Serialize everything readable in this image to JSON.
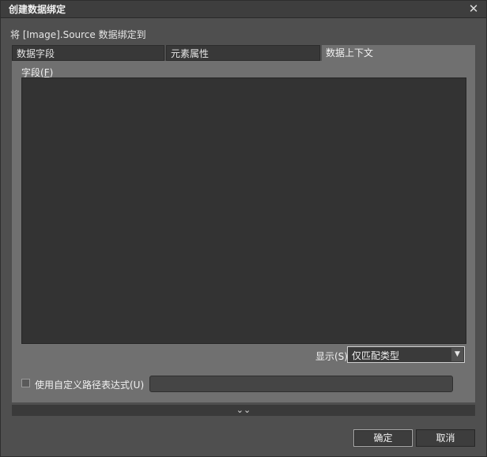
{
  "window": {
    "title": "创建数据绑定",
    "close_symbol": "✕"
  },
  "subtitle": "将 [Image].Source 数据绑定到",
  "tabs": [
    {
      "label": "数据字段"
    },
    {
      "label": "元素属性"
    },
    {
      "label": "数据上下文"
    }
  ],
  "field": {
    "label": "字段(",
    "accel": "F",
    "label_end": ")"
  },
  "show": {
    "label": "显示(S)",
    "selected": "仅匹配类型",
    "dropdown_icon": "chevron-down-icon"
  },
  "custom_path": {
    "checkbox_label": "使用自定义路径表达式(U)",
    "checked": false,
    "value": ""
  },
  "expander": {
    "symbol": "⌄⌄"
  },
  "buttons": {
    "ok": "确定",
    "cancel": "取消"
  }
}
